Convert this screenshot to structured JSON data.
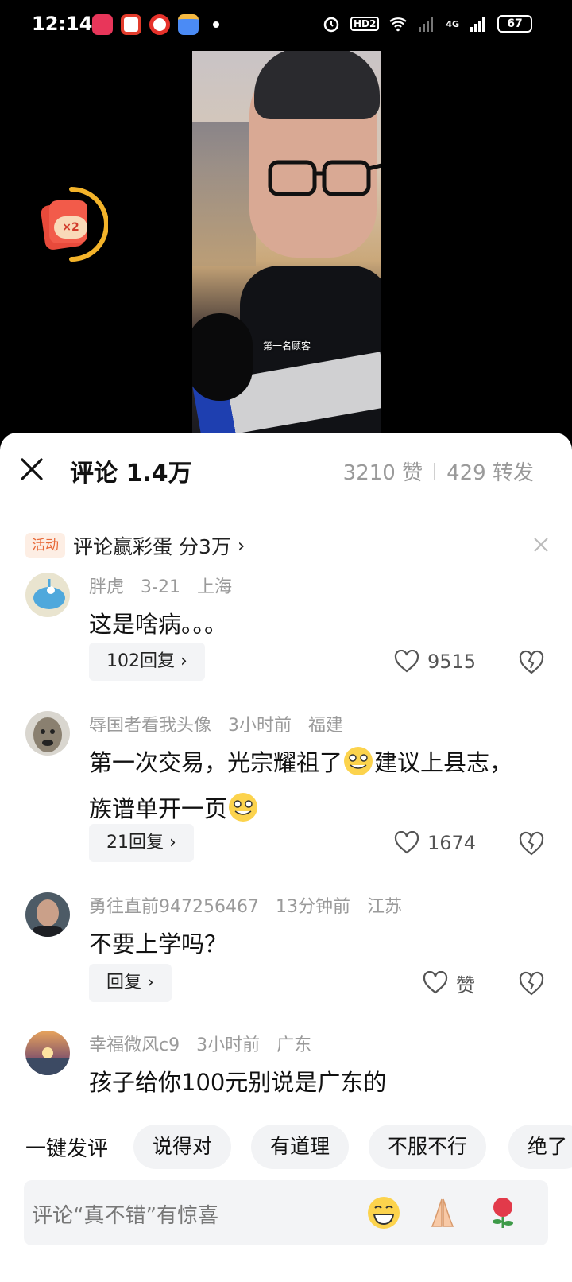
{
  "status_bar": {
    "time": "12:14",
    "battery": "67",
    "network": "4G",
    "hd": "HD2"
  },
  "video": {
    "caption": "第一名顾客"
  },
  "redpacket": {
    "label": "×2"
  },
  "sheet": {
    "title": "评论 1.4万",
    "likes": "3210 赞",
    "shares": "429 转发",
    "activity_badge": "活动",
    "activity_text": "评论赢彩蛋 分3万",
    "activity_chevron": "›"
  },
  "comments": [
    {
      "user": "胖虎",
      "time": "3-21",
      "location": "上海",
      "text": "这是啥病。。。",
      "reply_label": "102回复 ›",
      "like_count": "9515"
    },
    {
      "user": "辱国者看我头像",
      "time": "3小时前",
      "location": "福建",
      "text_part1": "第一次交易，光宗耀祖了",
      "text_part2": "建议上县志，族谱单开一页",
      "reply_label": "21回复 ›",
      "like_count": "1674"
    },
    {
      "user": "勇往直前947256467",
      "time": "13分钟前",
      "location": "江苏",
      "text": "不要上学吗？",
      "reply_label": "回复 ›",
      "like_count": "赞"
    },
    {
      "user": "幸福微风c9",
      "time": "3小时前",
      "location": "广东",
      "text": "孩子给你100元别说是广东的"
    }
  ],
  "quick_reply": {
    "label": "一键发评",
    "chips": [
      "说得对",
      "有道理",
      "不服不行",
      "绝了"
    ]
  },
  "input": {
    "placeholder": "评论“真不错”有惊喜"
  },
  "colors": {
    "accent_orange": "#e86a3a",
    "red_packet": "#e84a3b",
    "ring": "#f3b32a"
  }
}
